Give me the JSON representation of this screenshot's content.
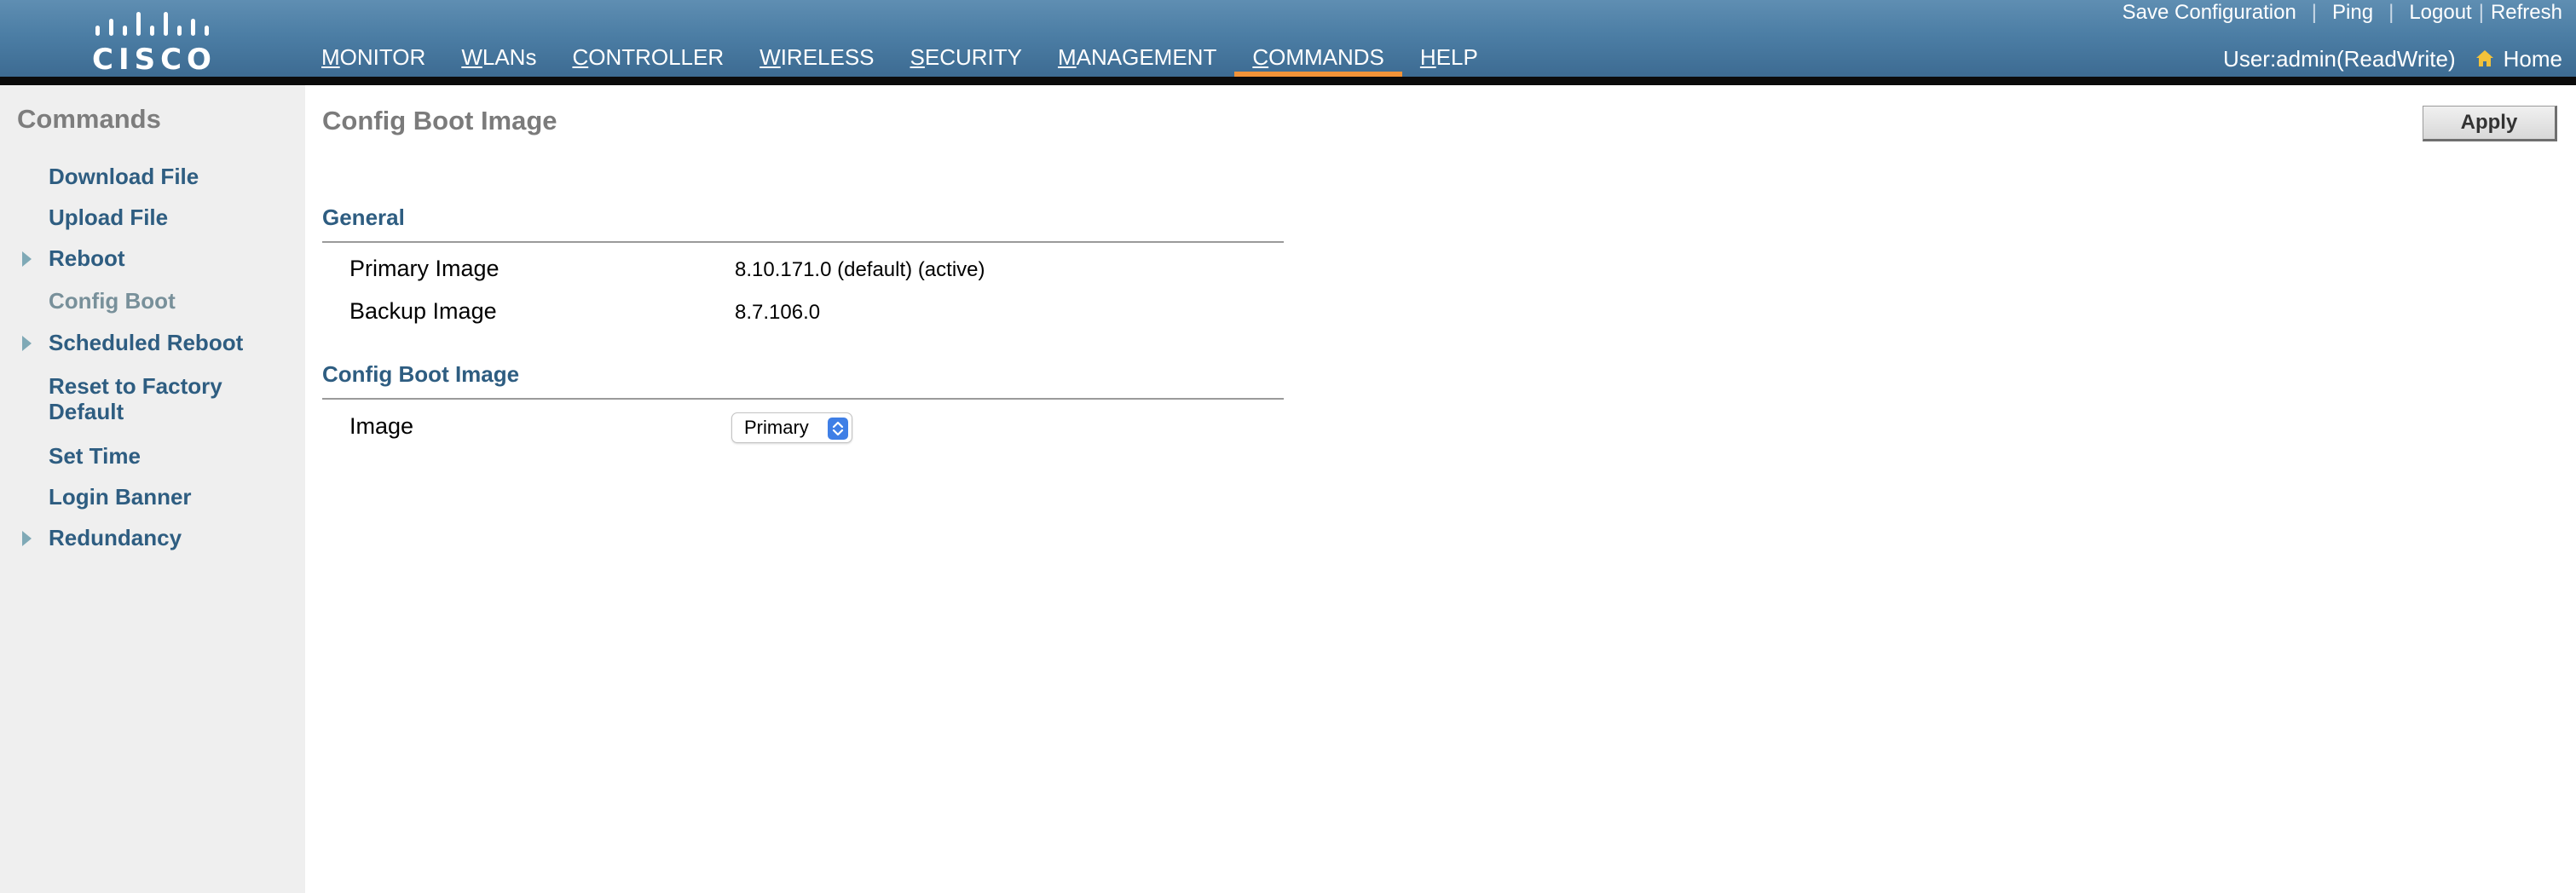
{
  "header": {
    "logo_text": "CISCO",
    "nav": [
      {
        "label": "MONITOR"
      },
      {
        "label": "WLANs"
      },
      {
        "label": "CONTROLLER"
      },
      {
        "label": "WIRELESS"
      },
      {
        "label": "SECURITY"
      },
      {
        "label": "MANAGEMENT"
      },
      {
        "label": "COMMANDS",
        "active": true
      },
      {
        "label": "HELP"
      }
    ],
    "links": {
      "save_configuration": "Save Configuration",
      "ping": "Ping",
      "logout": "Logout",
      "refresh": "Refresh",
      "separator": "|"
    },
    "user": "User:admin(ReadWrite)",
    "home": "Home",
    "accent_color": "#f29338"
  },
  "sidebar": {
    "title": "Commands",
    "items": [
      {
        "label": "Download File"
      },
      {
        "label": "Upload File"
      },
      {
        "label": "Reboot",
        "expandable": true
      },
      {
        "label": "Config Boot",
        "current": true
      },
      {
        "label": "Scheduled Reboot",
        "expandable": true
      },
      {
        "label": "Reset to Factory Default"
      },
      {
        "label": "Set Time"
      },
      {
        "label": "Login Banner"
      },
      {
        "label": "Redundancy",
        "expandable": true
      }
    ]
  },
  "main": {
    "title": "Config Boot Image",
    "apply_label": "Apply",
    "general": {
      "title": "General",
      "primary_label": "Primary Image",
      "primary_value": "8.10.171.0 (default) (active)",
      "backup_label": "Backup Image",
      "backup_value": "8.7.106.0"
    },
    "config": {
      "title": "Config Boot Image",
      "image_label": "Image",
      "image_selected": "Primary"
    }
  }
}
